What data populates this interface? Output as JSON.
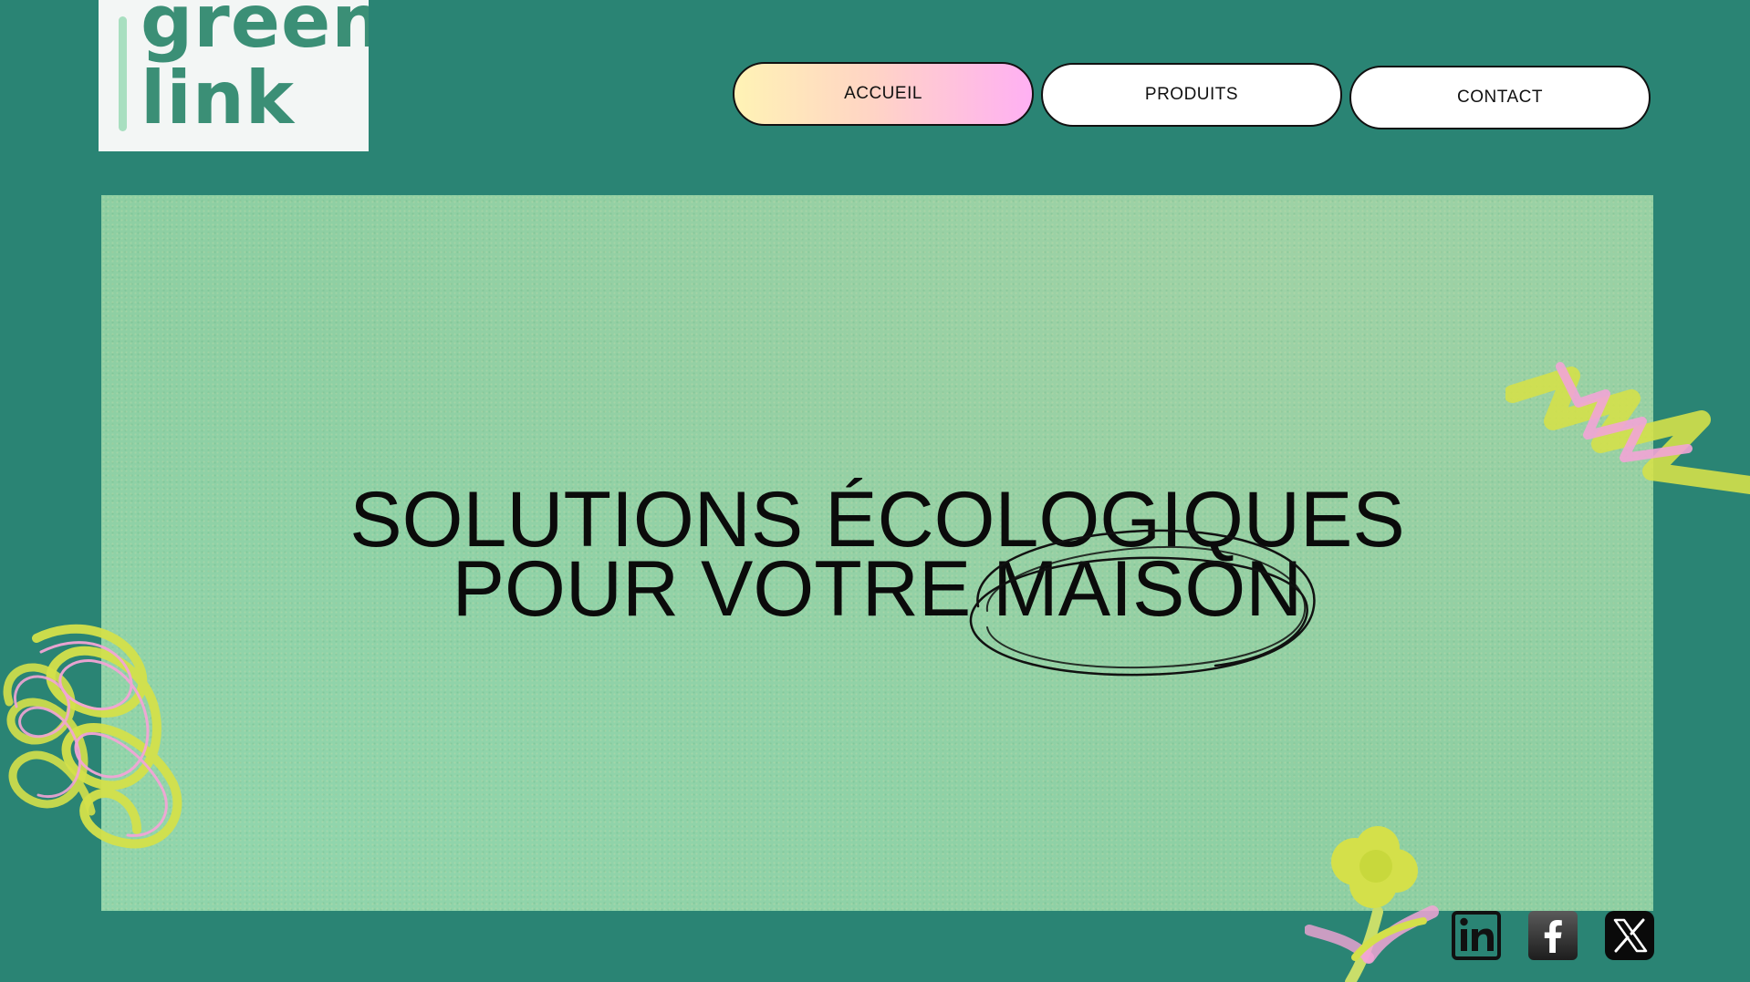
{
  "logo": {
    "line1": "green",
    "line2": "link"
  },
  "nav": {
    "items": [
      {
        "label": "ACCUEIL",
        "active": true
      },
      {
        "label": "PRODUITS",
        "active": false
      },
      {
        "label": "CONTACT",
        "active": false
      }
    ]
  },
  "hero": {
    "headline_line1": "SOLUTIONS ÉCOLOGIQUES",
    "headline_line2": "POUR VOTRE MAISON"
  },
  "socials": {
    "items": [
      {
        "icon": "linkedin-icon"
      },
      {
        "icon": "facebook-icon"
      },
      {
        "icon": "x-icon"
      }
    ]
  },
  "colors": {
    "background": "#2a8474",
    "hero": "#8ecfa3",
    "logo_text": "#3b8f76",
    "active_gradient_start": "#fff3b5",
    "active_gradient_end": "#ffb0f3",
    "scribble_yellow": "#d4e04a",
    "scribble_pink": "#f2a4d6"
  }
}
